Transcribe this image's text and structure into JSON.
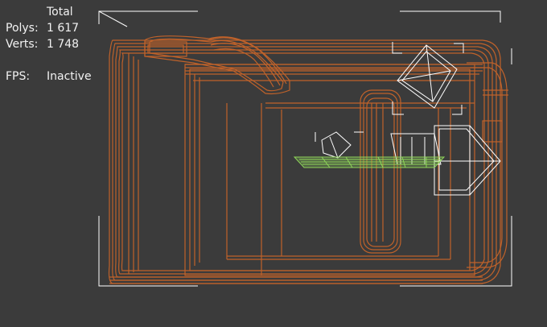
{
  "stats": {
    "header": "Total",
    "polys_label": "Polys:",
    "polys_value": "1 617",
    "verts_label": "Verts:",
    "verts_value": "1 748",
    "fps_label": "FPS:",
    "fps_value": "Inactive"
  },
  "colors": {
    "background": "#3b3b3b",
    "wire_orange": "#c0622a",
    "wire_white": "#ffffff",
    "wire_green": "#8fd65a",
    "text": "#f2f2f2"
  }
}
